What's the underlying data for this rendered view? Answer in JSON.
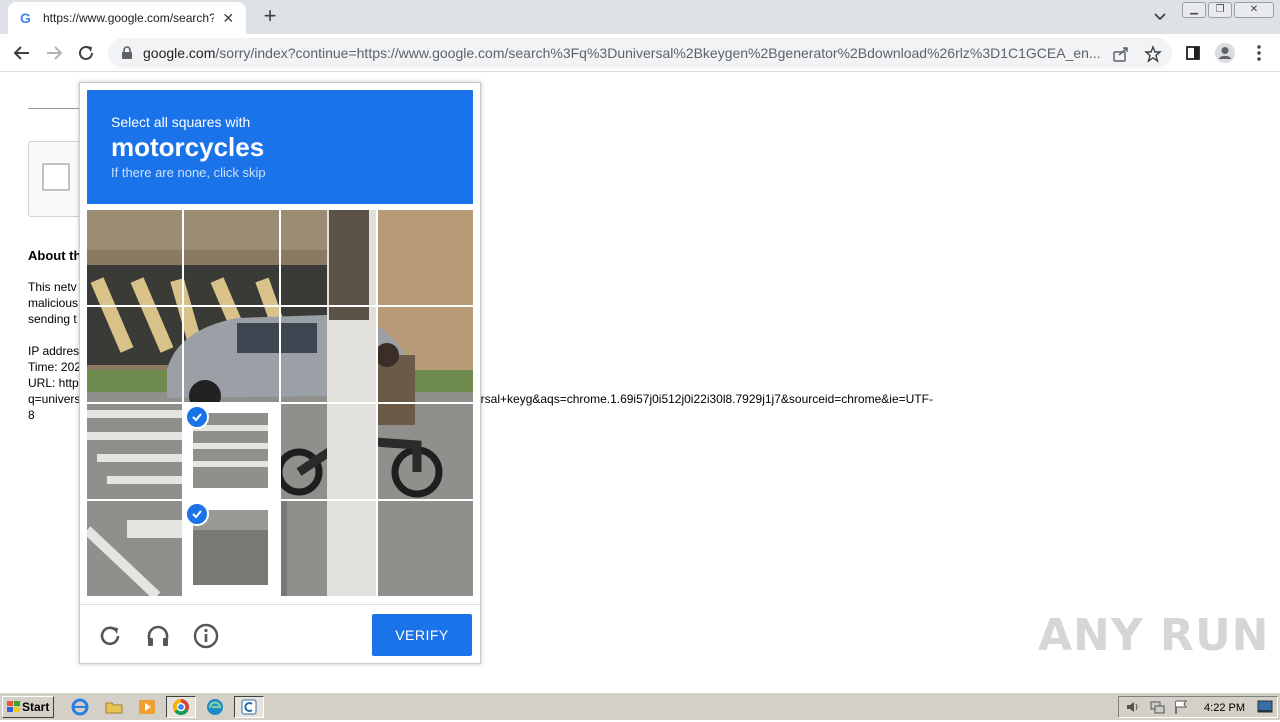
{
  "browser": {
    "tab": {
      "title": "https://www.google.com/search?q="
    },
    "omnibox": {
      "host": "google.com",
      "path": "/sorry/index?continue=https://www.google.com/search%3Fq%3Duniversal%2Bkeygen%2Bgenerator%2Bdownload%26rlz%3D1C1GCEA_en..."
    },
    "window_controls": [
      "minimize",
      "restore",
      "close"
    ]
  },
  "page": {
    "about_title": "About th",
    "lines": [
      "This netv",
      "malicious",
      "sending t",
      "",
      "IP addres",
      "Time: 202",
      "URL: http",
      "q=univers",
      "8"
    ],
    "url_tail": "ersal+keyg&aqs=chrome.1.69i57j0i512j0i22i30l8.7929j1j7&sourceid=chrome&ie=UTF-"
  },
  "captcha": {
    "instruction": "Select all squares with",
    "target": "motorcycles",
    "hint": "If there are none, click skip",
    "selected_tiles": [
      9,
      13
    ],
    "verify_label": "VERIFY",
    "footer_icons": [
      "reload-icon",
      "audio-icon",
      "info-icon"
    ],
    "accent": "#1a73e8"
  },
  "watermark": "ANY RUN",
  "taskbar": {
    "start_label": "Start",
    "clock": "4:22 PM"
  }
}
